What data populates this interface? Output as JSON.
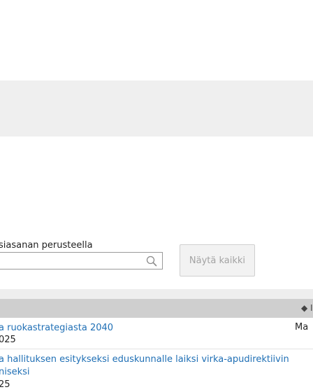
{
  "search": {
    "label": "siasanan perusteella",
    "value": "",
    "placeholder": "",
    "icon": "search-icon"
  },
  "buttons": {
    "show_all": "Näytä kaikki"
  },
  "table": {
    "sort_header": "◆ I",
    "rows": [
      {
        "title_lines": [
          "a ruokastrategiasta 2040"
        ],
        "date": "025",
        "extra": "Ma"
      },
      {
        "title_lines": [
          "a hallituksen esitykseksi eduskunnalle laiksi virka-apudirektiivin",
          "niseksi"
        ],
        "date": "25",
        "extra": ""
      }
    ]
  },
  "colors": {
    "link": "#1f6fb5",
    "band": "#efefef",
    "header": "#cfcfcf"
  }
}
